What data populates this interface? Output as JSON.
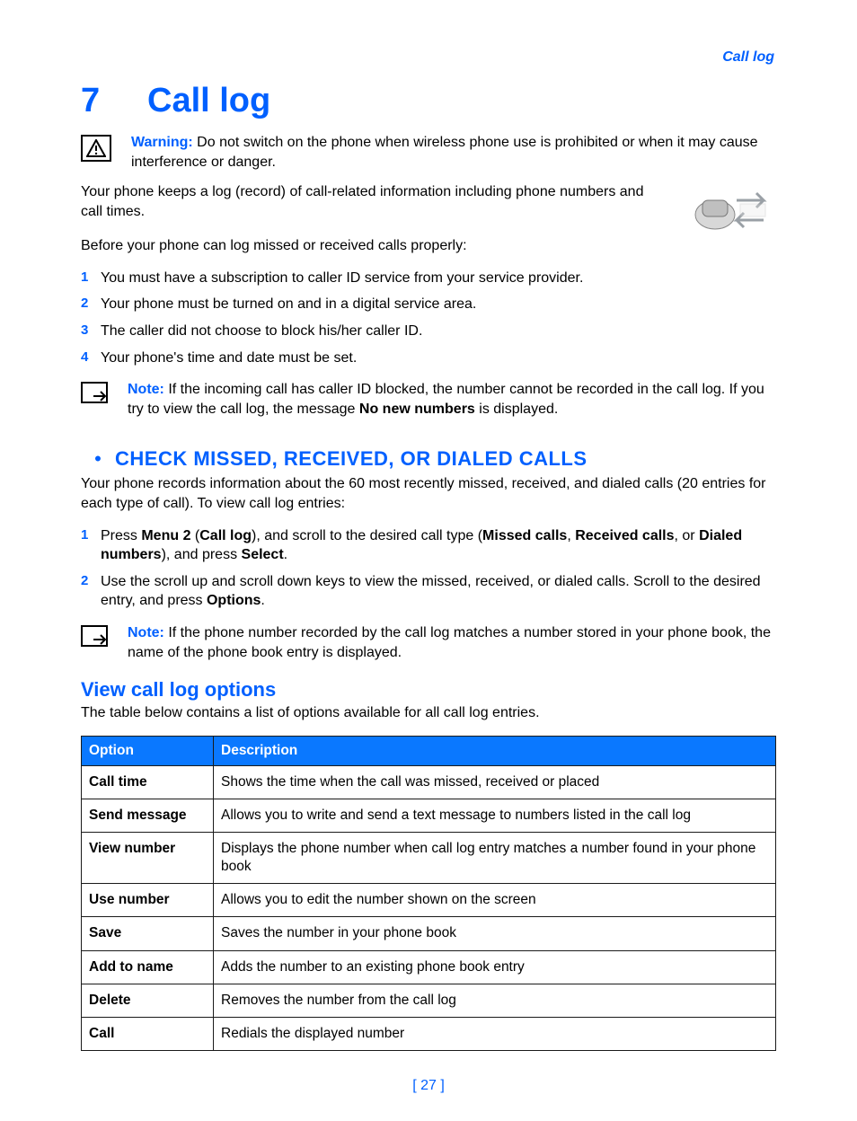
{
  "running_head": "Call log",
  "chapter": {
    "num": "7",
    "title": "Call log"
  },
  "warning": {
    "label": "Warning:",
    "text": " Do not switch on the phone when wireless phone use is prohibited or when it may cause interference or danger."
  },
  "intro_para": "Your phone keeps a log (record) of call-related information including phone numbers and call times.",
  "precond_para": "Before your phone can log missed or received calls properly:",
  "precond_list": [
    "You must have a subscription to caller ID service from your service provider.",
    "Your phone must be turned on and in a digital service area.",
    "The caller did not choose to block his/her caller ID.",
    "Your phone's time and date must be set."
  ],
  "note1": {
    "label": "Note:",
    "text_before": " If the incoming call has caller ID blocked, the number cannot be recorded in the call log. If you try to view the call log, the message ",
    "bold": "No new numbers",
    "text_after": " is displayed."
  },
  "section2_title": "CHECK MISSED, RECEIVED, OR DIALED CALLS",
  "section2_intro": "Your phone records information about the 60 most recently missed, received, and dialed calls (20 entries for each type of call). To view call log entries:",
  "step1": {
    "a": "Press ",
    "b1": "Menu 2",
    "c": " (",
    "b2": "Call log",
    "d": "), and scroll to the desired call type (",
    "b3": "Missed calls",
    "e": ", ",
    "b4": "Received calls",
    "f": ", or ",
    "b5": "Dialed numbers",
    "g": "), and press ",
    "b6": "Select",
    "h": "."
  },
  "step2": {
    "a": "Use the scroll up and scroll down keys to view the missed, received, or dialed calls. Scroll to the desired entry, and press ",
    "b": "Options",
    "c": "."
  },
  "note2": {
    "label": "Note:",
    "text": " If the phone number recorded by the call log matches a number stored in your phone book, the name of the phone book entry is displayed."
  },
  "section3_title": "View call log options",
  "section3_intro": "The table below contains a list of options available for all call log entries.",
  "table": {
    "head_option": "Option",
    "head_desc": "Description",
    "rows": [
      {
        "opt": "Call time",
        "desc": "Shows the time when the call was missed, received or placed"
      },
      {
        "opt": "Send message",
        "desc": "Allows you to write and send a text message to numbers listed in the call log"
      },
      {
        "opt": "View number",
        "desc": "Displays the phone number when call log entry matches a number found in your phone book"
      },
      {
        "opt": "Use number",
        "desc": "Allows you to edit the number shown on the screen"
      },
      {
        "opt": "Save",
        "desc": "Saves the number in your phone book"
      },
      {
        "opt": "Add to name",
        "desc": "Adds the number to an existing phone book entry"
      },
      {
        "opt": "Delete",
        "desc": "Removes the number from the call log"
      },
      {
        "opt": "Call",
        "desc": "Redials the displayed number"
      }
    ]
  },
  "page_number": "[ 27 ]"
}
